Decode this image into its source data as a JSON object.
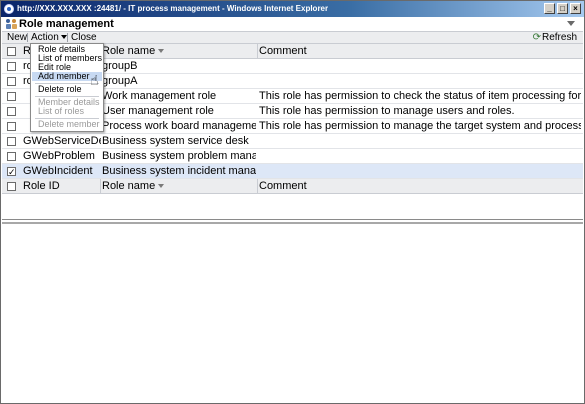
{
  "window": {
    "title": "http://XXX.XXX.XXX :24481/ - IT process management - Windows Internet Explorer",
    "buttons": [
      "_",
      "□",
      "×"
    ]
  },
  "header": {
    "title": "Role management",
    "icon": "role-management-icon"
  },
  "toolbar": {
    "new_label": "New",
    "action_label": "Action",
    "close_label": "Close",
    "refresh_label": "Refresh"
  },
  "table": {
    "columns": [
      "Role ID",
      "Role name",
      "Comment"
    ],
    "rows": [
      {
        "id": "ro",
        "name": "groupB",
        "comment": "",
        "checked": false
      },
      {
        "id": "ro",
        "name": "groupA",
        "comment": "",
        "checked": false
      },
      {
        "id": "",
        "name": "Work management role",
        "comment": "This role has permission to check the status of item processing for the entire system.",
        "checked": false
      },
      {
        "id": "",
        "name": "User management role",
        "comment": "This role has permission to manage users and roles.",
        "checked": false
      },
      {
        "id": "",
        "name": "Process work board management role",
        "comment": "This role has permission to manage the target system and process work boards.",
        "checked": false
      },
      {
        "id": "GWebServiceDesk",
        "name": "Business system service desk",
        "comment": "",
        "checked": false
      },
      {
        "id": "GWebProblem",
        "name": "Business system problem management",
        "comment": "",
        "checked": false
      },
      {
        "id": "GWebIncident",
        "name": "Business system incident management",
        "comment": "",
        "checked": true
      }
    ],
    "header_id_fragment": "R"
  },
  "action_menu": {
    "items": [
      {
        "label": "Role details",
        "disabled": false
      },
      {
        "label": "List of members",
        "disabled": false
      },
      {
        "label": "Edit role",
        "disabled": false
      },
      {
        "label": "Add member",
        "disabled": false,
        "highlighted": true
      },
      {
        "label": "Delete role",
        "disabled": false
      },
      {
        "label": "Member details",
        "disabled": true
      },
      {
        "label": "List of roles",
        "disabled": true
      },
      {
        "label": "Delete member",
        "disabled": true
      }
    ]
  },
  "colors": {
    "toolbar_bg": "#ecedef",
    "selected_row": "#dde7f7",
    "menu_highlight": "#c7d9f2",
    "titlebar": "#0a246a"
  }
}
